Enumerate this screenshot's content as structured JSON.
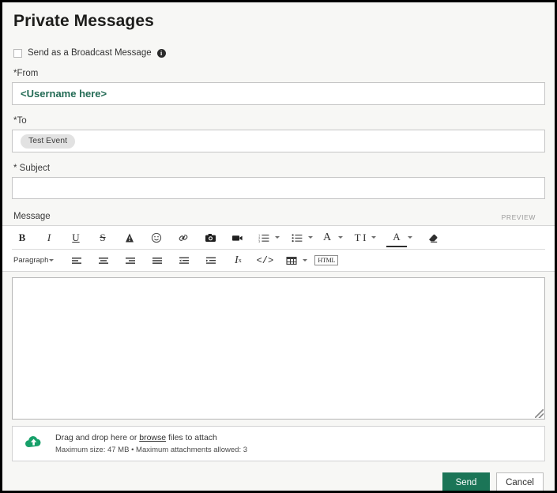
{
  "page": {
    "title": "Private Messages"
  },
  "broadcast": {
    "label": "Send as a Broadcast Message",
    "info_glyph": "i",
    "checked": false
  },
  "from": {
    "label": "*From",
    "value": "<Username here>",
    "value_color": "#236b55"
  },
  "to": {
    "label": "*To",
    "chips": [
      "Test Event"
    ]
  },
  "subject": {
    "label": "* Subject",
    "value": "",
    "placeholder": ""
  },
  "message": {
    "label": "Message",
    "preview_label": "PREVIEW",
    "value": "",
    "placeholder": ""
  },
  "toolbar": {
    "row1": [
      {
        "name": "bold-icon",
        "glyph": "B"
      },
      {
        "name": "italic-icon",
        "glyph": "I"
      },
      {
        "name": "underline-icon",
        "glyph": "U"
      },
      {
        "name": "strikethrough-icon",
        "glyph": "S"
      },
      {
        "name": "text-highlight-icon",
        "glyph": "A"
      },
      {
        "name": "emoji-icon",
        "glyph": "smiley"
      },
      {
        "name": "link-icon",
        "glyph": "link"
      },
      {
        "name": "image-icon",
        "glyph": "camera"
      },
      {
        "name": "video-icon",
        "glyph": "videocamera"
      },
      {
        "name": "ordered-list-icon",
        "glyph": "numbered-list"
      },
      {
        "name": "unordered-list-icon",
        "glyph": "bullet-list"
      },
      {
        "name": "font-family-icon",
        "glyph": "A"
      },
      {
        "name": "font-size-icon",
        "glyph": "TI"
      },
      {
        "name": "font-color-icon",
        "glyph": "A-underline"
      },
      {
        "name": "clear-formatting-icon",
        "glyph": "eraser"
      }
    ],
    "row2": [
      {
        "name": "paragraph-style-dropdown",
        "label": "Paragraph"
      },
      {
        "name": "align-left-icon",
        "glyph": "align-left"
      },
      {
        "name": "align-center-icon",
        "glyph": "align-center"
      },
      {
        "name": "align-right-icon",
        "glyph": "align-right"
      },
      {
        "name": "align-justify-icon",
        "glyph": "align-justify"
      },
      {
        "name": "outdent-icon",
        "glyph": "outdent"
      },
      {
        "name": "indent-icon",
        "glyph": "indent"
      },
      {
        "name": "remove-format-icon",
        "glyph": "Ix"
      },
      {
        "name": "source-code-icon",
        "glyph": "</>"
      },
      {
        "name": "insert-table-icon",
        "glyph": "table"
      },
      {
        "name": "html-button",
        "label": "HTML"
      }
    ]
  },
  "attachment": {
    "line1_prefix": "Drag and drop here or ",
    "browse_link": "browse",
    "line1_suffix": " files to attach",
    "line2": "Maximum size: 47 MB • Maximum attachments allowed: 3"
  },
  "footer": {
    "send_label": "Send",
    "cancel_label": "Cancel",
    "send_color": "#1b7557"
  }
}
